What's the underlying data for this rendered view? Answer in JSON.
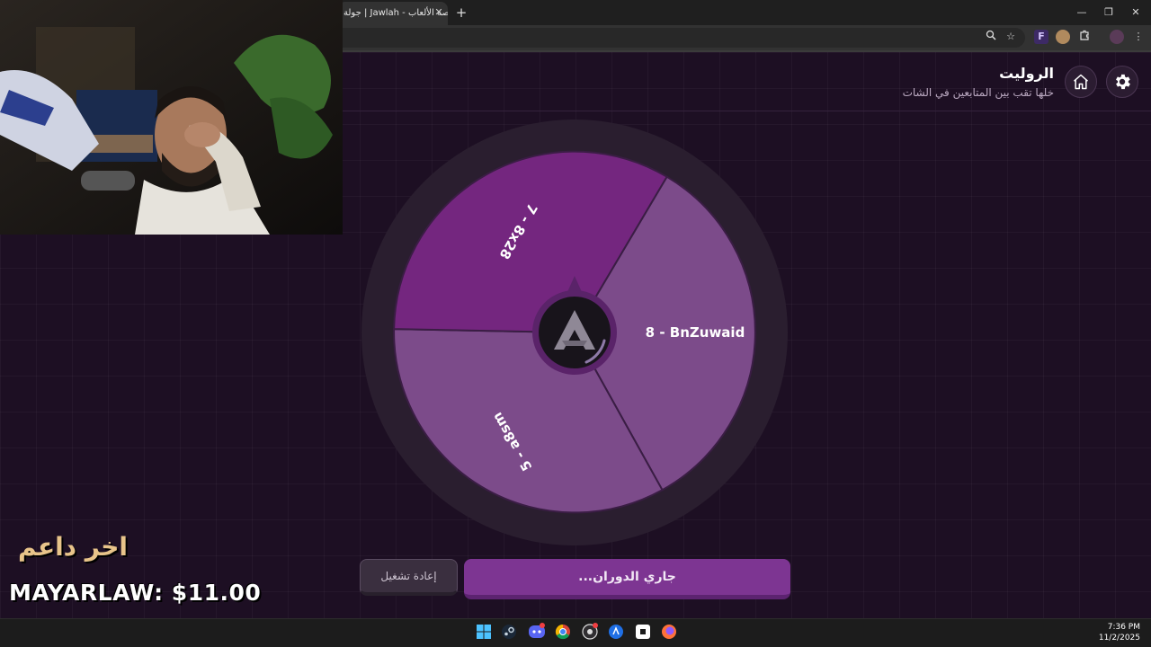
{
  "browser": {
    "tab_title": "جولة | Jawlah - منصة الألعاب",
    "tab_close": "✕",
    "new_tab": "+",
    "window_controls": [
      "—",
      "❐",
      "✕"
    ]
  },
  "header": {
    "title": "الروليت",
    "subtitle": "خلها تقب بين المتابعين في الشات"
  },
  "wheel": {
    "segments": [
      {
        "label": "8 - BnZuwaid",
        "color": "#7c4b8a"
      },
      {
        "label": "5 - a8sm",
        "color": "#7c4b8a"
      },
      {
        "label": "7 - 8x28",
        "color": "#74267f"
      }
    ],
    "colors": {
      "ring": "#2a1e2f",
      "hub": "#18141b"
    }
  },
  "buttons": {
    "spinning": "جاري الدوران...",
    "reset": "إعادة تشغيل"
  },
  "overlay": {
    "last_supporter_label": "اخر داعم",
    "last_supporter": "MAYARLAW: $11.00"
  },
  "taskbar": {
    "time": "7:36 PM",
    "date": "11/2/2025",
    "apps": [
      "windows-start",
      "steam",
      "discord",
      "chrome",
      "obs",
      "app-blue",
      "roblox",
      "firefox"
    ]
  }
}
